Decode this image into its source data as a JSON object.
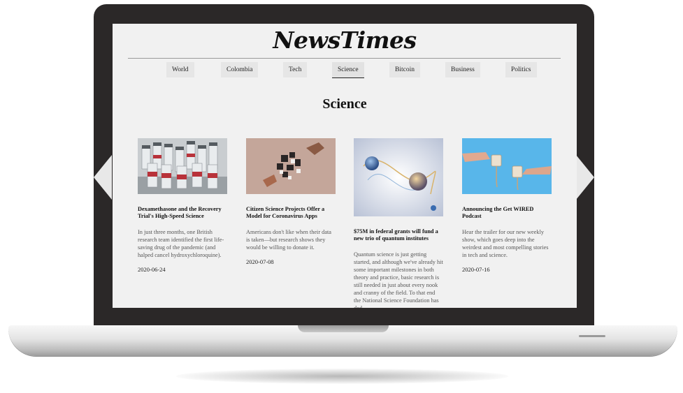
{
  "site": {
    "logo": "NewsTimes"
  },
  "nav": {
    "items": [
      "World",
      "Colombia",
      "Tech",
      "Science",
      "Bitcoin",
      "Business",
      "Politics"
    ],
    "active": "Science"
  },
  "section": {
    "title": "Science"
  },
  "articles": [
    {
      "title": "Dexamethasone and the Recovery Trial's High-Speed Science",
      "summary": "In just three months, one British research team identified the first life-saving drug of the pandemic (and halped cancel hydroxychloroquine).",
      "date": "2020-06-24",
      "image_icon": "medicine-vials-image"
    },
    {
      "title": "Citizen Science Projects Offer a Model for Coronavirus Apps",
      "summary": "Americans don't like when their data is taken—but research shows they would be willing to donate it.",
      "date": "2020-07-08",
      "image_icon": "puzzle-pieces-image"
    },
    {
      "title": "$75M in federal grants will fund a new trio of quantum institutes",
      "summary": "Quantum science is just getting started, and although we've already hit some important milestones in both theory and practice, basic research is still needed in just about every nook and cranny of the field. To that end the National Science Foundation has ded...",
      "date": "",
      "image_icon": "quantum-spheres-image"
    },
    {
      "title": "Announcing the Get WIRED Podcast",
      "summary": "Hear the trailer for our new weekly show, which goes deep into the weirdest and most compelling stories in tech and science.",
      "date": "2020-07-16",
      "image_icon": "coffee-cups-image"
    }
  ]
}
